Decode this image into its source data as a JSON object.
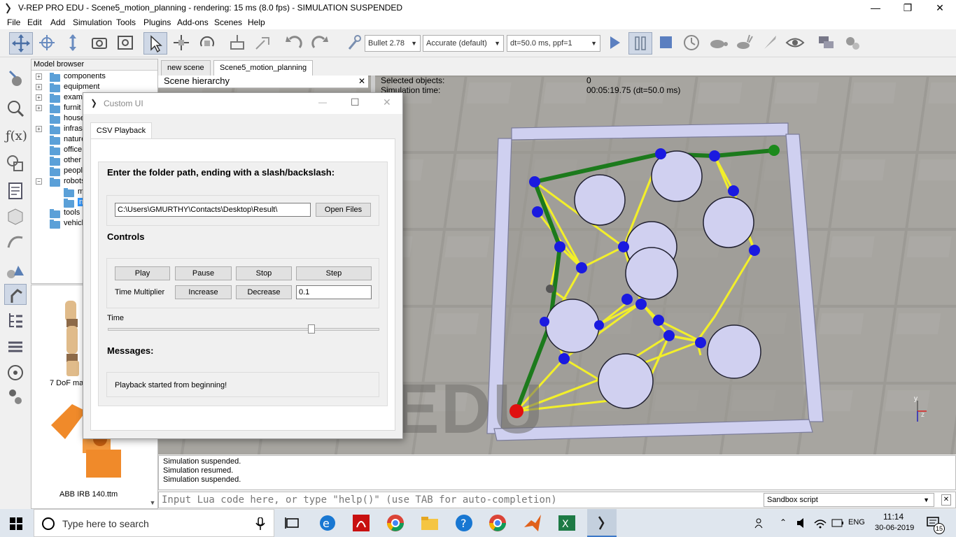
{
  "window": {
    "title": "V-REP PRO EDU - Scene5_motion_planning - rendering: 15 ms (8.0 fps) - SIMULATION SUSPENDED",
    "minimize": "—",
    "maximize": "❐",
    "close": "✕"
  },
  "menu": [
    "File",
    "Edit",
    "Add",
    "Simulation",
    "Tools",
    "Plugins",
    "Add-ons",
    "Scenes",
    "Help"
  ],
  "toolbar": {
    "engine": "Bullet 2.78",
    "accuracy": "Accurate (default)",
    "timestep": "dt=50.0 ms, ppf=1"
  },
  "model_browser": {
    "header": "Model browser",
    "items": [
      {
        "label": "components",
        "expandable": true
      },
      {
        "label": "equipment",
        "expandable": true
      },
      {
        "label": "examp",
        "expandable": true
      },
      {
        "label": "furnit",
        "expandable": true
      },
      {
        "label": "house",
        "expandable": false
      },
      {
        "label": "infras",
        "expandable": true
      },
      {
        "label": "nature",
        "expandable": false
      },
      {
        "label": "office",
        "expandable": false
      },
      {
        "label": "other",
        "expandable": false
      },
      {
        "label": "people",
        "expandable": false
      },
      {
        "label": "robots",
        "expandable": true
      },
      {
        "label": "m",
        "expandable": false
      },
      {
        "label": "no",
        "expandable": false
      },
      {
        "label": "tools",
        "expandable": false
      },
      {
        "label": "vehicl",
        "expandable": false
      }
    ],
    "thumbs": [
      "7 DoF man",
      "ABB IRB 140.ttm"
    ]
  },
  "scene_tabs": [
    "new scene",
    "Scene5_motion_planning"
  ],
  "hierarchy": {
    "title": "Scene hierarchy",
    "close": "✕"
  },
  "info": {
    "selected_label": "Selected objects:",
    "selected_value": "0",
    "time_label": "Simulation time:",
    "time_value": "00:05:19.75 (dt=50.0 ms)"
  },
  "watermark": "EDU",
  "dialog": {
    "title": "Custom UI",
    "tab": "CSV Playback",
    "folder_prompt": "Enter the folder path, ending with a slash/backslash:",
    "path_value": "C:\\Users\\GMURTHY\\Contacts\\Desktop\\Result\\",
    "open_files": "Open Files",
    "controls_heading": "Controls",
    "play": "Play",
    "pause": "Pause",
    "stop": "Stop",
    "step": "Step",
    "time_multiplier": "Time Multiplier",
    "increase": "Increase",
    "decrease": "Decrease",
    "multiplier_value": "0.1",
    "time_label": "Time",
    "time_slider_fraction": 0.75,
    "messages_heading": "Messages:",
    "message": "Playback started from beginning!"
  },
  "console": {
    "lines": [
      "Simulation suspended.",
      "Simulation resumed.",
      "Simulation suspended."
    ]
  },
  "lua": {
    "placeholder": "Input Lua code here, or type \"help()\" (use TAB for auto-completion)",
    "script": "Sandbox script"
  },
  "taskbar": {
    "search_placeholder": "Type here to search",
    "language": "ENG",
    "time": "11:14",
    "date": "30-06-2019",
    "notifications": "15"
  }
}
